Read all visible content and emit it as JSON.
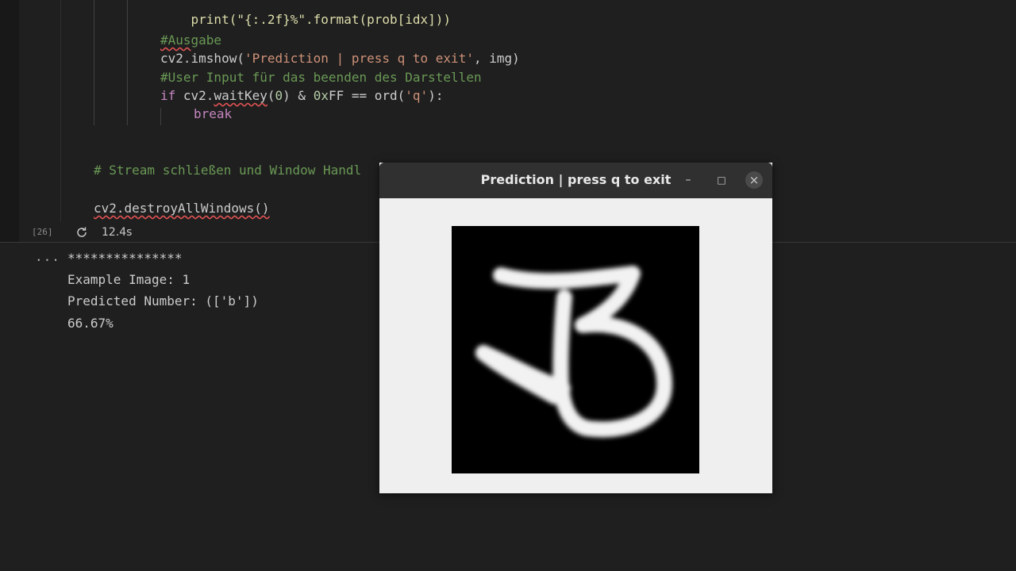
{
  "editor": {
    "code": {
      "print_line": "print(\"{:.2f}%\".format(prob[idx]))",
      "comment_ausgabe_pre": "#Aus",
      "comment_ausgabe_post": "gabe",
      "imshow_call": "cv2.imshow(",
      "imshow_string": "'Prediction | press q to exit'",
      "imshow_rest": ", img)",
      "comment_user_input": "#User Input für das beenden des Darstellen",
      "if_kw": "if",
      "cv2_prefix": " cv2.",
      "waitkey_fn": "waitKey",
      "waitkey_args_open": "(",
      "zero": "0",
      "waitkey_mid": ") & ",
      "hex_prefix": "0x",
      "hex_val": "FF",
      "eq_ord": " == ord(",
      "q_string": "'q'",
      "close_colon": "):",
      "break_kw": "break",
      "comment_stream": "# Stream schließen und Window Handl",
      "destroy_line": "cv2.destroyAllWindows()"
    },
    "status": {
      "exec_count": "[26]",
      "exec_time": "12.4s",
      "icon": "refresh-icon"
    }
  },
  "output": {
    "more_label": "...",
    "lines": [
      "***************",
      "Example Image: 1",
      "Predicted Number: (['b'])",
      "66.67%"
    ]
  },
  "window": {
    "title": "Prediction | press q to exit",
    "minimize_glyph": "–",
    "maximize_glyph": "□",
    "close_glyph": "×"
  }
}
